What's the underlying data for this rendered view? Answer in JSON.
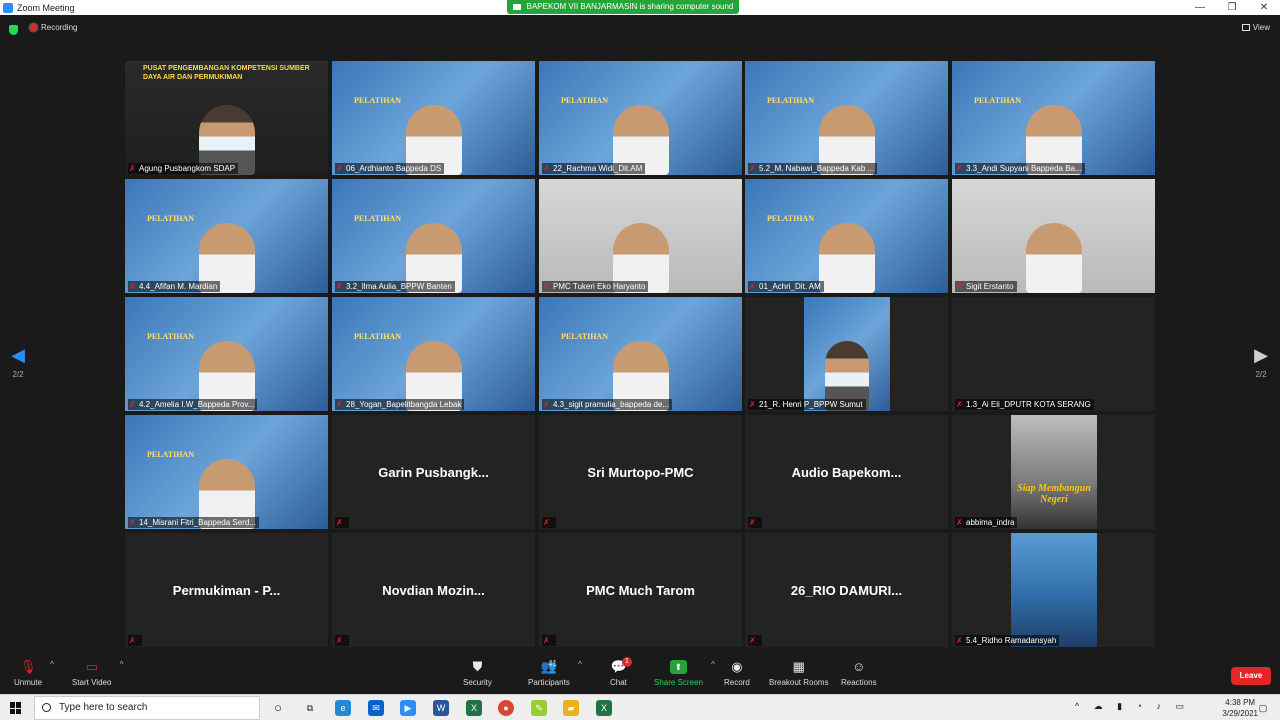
{
  "window": {
    "title": "Zoom Meeting",
    "controls": [
      "—",
      "❐",
      "✕"
    ]
  },
  "share_banner": "BAPEKOM VII BANJARMASIN is sharing computer sound",
  "topbar": {
    "recording_label": "Recording",
    "view_label": "View"
  },
  "pager": {
    "left_page": "2/2",
    "right_page": "2/2"
  },
  "tiles": [
    {
      "name": "Agung Pusbangkom SDAP",
      "kind": "banner",
      "banner": "PUSAT PENGEMBANGAN KOMPETENSI SUMBER DAYA AIR DAN PERMUKIMAN",
      "active": true
    },
    {
      "name": "06_Ardhianto Bappeda DS",
      "kind": "slide",
      "slide": "PELATIHAN"
    },
    {
      "name": "22_Rachma Widi_Dit.AM",
      "kind": "slide",
      "slide": "PELATIHAN"
    },
    {
      "name": "5.2_M. Nabawi_Bappeda Kab ...",
      "kind": "slide",
      "slide": "PELATIHAN"
    },
    {
      "name": "3.3_Andi Supyani Bappeda Ba...",
      "kind": "slide",
      "slide": "PELATIHAN"
    },
    {
      "name": "4.4_Afifan M. Mardian",
      "kind": "slide",
      "slide": "PELATIHAN"
    },
    {
      "name": "3.2_Ilma Aulia_BPPW Banten",
      "kind": "slide",
      "slide": "PELATIHAN"
    },
    {
      "name": "PMC Tukeri Eko Haryanto",
      "kind": "gray"
    },
    {
      "name": "01_Achri_Dit. AM",
      "kind": "slide",
      "slide": "PELATIHAN"
    },
    {
      "name": "Sigit Erstanto",
      "kind": "gray"
    },
    {
      "name": "4.2_Amelia I.W_Bappeda Prov...",
      "kind": "slide",
      "slide": "PELATIHAN"
    },
    {
      "name": "28_Yogan_Bapelitbangda Lebak",
      "kind": "slide",
      "slide": "PELATIHAN"
    },
    {
      "name": "4.3_sigit pramulia_bappeda de...",
      "kind": "slide",
      "slide": "PELATIHAN"
    },
    {
      "name": "21_R. Henri P_BPPW Sumut",
      "kind": "narrow"
    },
    {
      "name": "1.3_Ai Eli_DPUTR KOTA SERANG",
      "kind": "empty"
    },
    {
      "name": "14_Misrani Fitri_Bappeda Serd...",
      "kind": "slide",
      "slide": "PELATIHAN"
    },
    {
      "name": "",
      "kind": "text",
      "display": "Garin  Pusbangk..."
    },
    {
      "name": "",
      "kind": "text",
      "display": "Sri Murtopo-PMC"
    },
    {
      "name": "",
      "kind": "text",
      "display": "Audio  Bapekom..."
    },
    {
      "name": "abbima_indra",
      "kind": "logo",
      "logo_text": "Siap Membangun Negeri"
    },
    {
      "name": "",
      "kind": "text",
      "display": "Permukiman  -  P..."
    },
    {
      "name": "",
      "kind": "text",
      "display": "Novdian  Mozin..."
    },
    {
      "name": "",
      "kind": "text",
      "display": "PMC Much Tarom"
    },
    {
      "name": "",
      "kind": "text",
      "display": "26_RIO  DAMURI..."
    },
    {
      "name": "5.4_Ridho Ramadansyah",
      "kind": "photo"
    }
  ],
  "toolbar": {
    "unmute": "Unmute",
    "start_video": "Start Video",
    "security": "Security",
    "participants": "Participants",
    "participants_count": "41",
    "chat": "Chat",
    "chat_badge": "1",
    "share_screen": "Share Screen",
    "record": "Record",
    "breakout_rooms": "Breakout Rooms",
    "reactions": "Reactions",
    "leave": "Leave"
  },
  "taskbar": {
    "search_placeholder": "Type here to search",
    "time": "4:38 PM",
    "date": "3/29/2021"
  },
  "colors": {
    "share_green": "#23a637",
    "leave_red": "#e02828",
    "active_speaker": "#f5d211",
    "zoom_blue": "#2d8cff"
  }
}
